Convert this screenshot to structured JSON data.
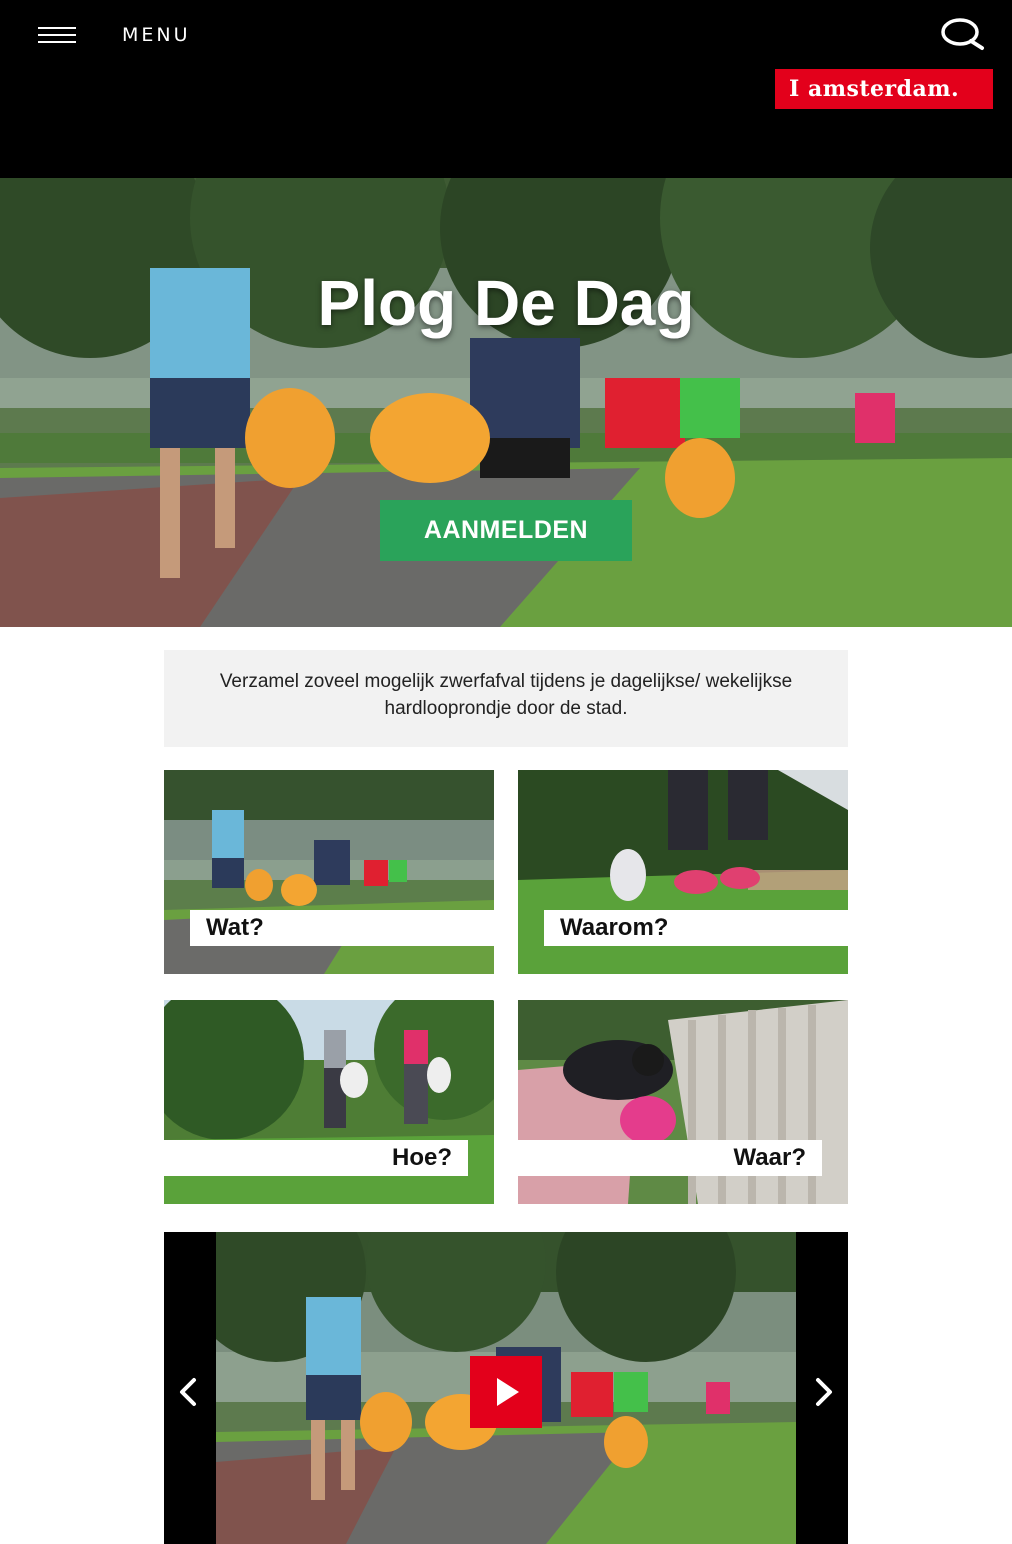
{
  "header": {
    "menu_label": "MENU",
    "logo_text": "I amsterdam."
  },
  "hero": {
    "title": "Plog De Dag",
    "cta_label": "AANMELDEN"
  },
  "intro": {
    "text": "Verzamel zoveel mogelijk zwerfafval tijdens je dagelijkse/ wekelijkse hardlooprondje door de stad."
  },
  "tiles": [
    {
      "label": "Wat?"
    },
    {
      "label": "Waarom?"
    },
    {
      "label": "Hoe?"
    },
    {
      "label": "Waar?"
    }
  ],
  "colors": {
    "brand_red": "#e3001b",
    "cta_green": "#2aa35a",
    "header_black": "#000000"
  },
  "icons": {
    "menu": "hamburger-icon",
    "search": "search-icon",
    "prev": "chevron-left-icon",
    "next": "chevron-right-icon",
    "play": "play-icon"
  }
}
